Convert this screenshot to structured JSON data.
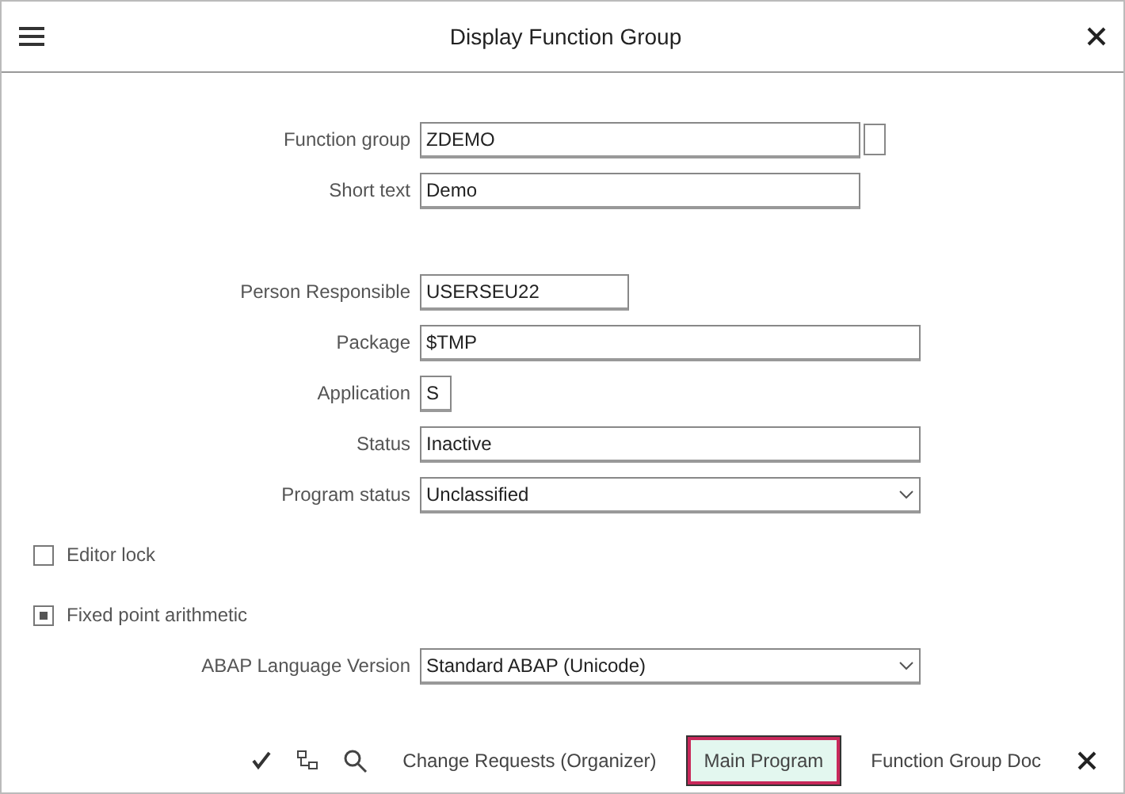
{
  "window": {
    "title": "Display Function Group"
  },
  "fields": [
    {
      "kind": "input",
      "label": "Function group",
      "value": "ZDEMO"
    },
    {
      "kind": "input",
      "label": "Short text",
      "value": "Demo"
    },
    {
      "kind": "gap"
    },
    {
      "kind": "input",
      "label": "Person Responsible",
      "value": "USERSEU22"
    },
    {
      "kind": "input",
      "label": "Package",
      "value": "$TMP"
    },
    {
      "kind": "input",
      "label": "Application",
      "value": "S"
    },
    {
      "kind": "input",
      "label": "Status",
      "value": "Inactive"
    },
    {
      "kind": "select",
      "label": "Program status",
      "value": "Unclassified"
    },
    {
      "kind": "checkbox",
      "label": "Editor lock",
      "checked": false
    },
    {
      "kind": "checkbox",
      "label": "Fixed point arithmetic",
      "checked": true
    },
    {
      "kind": "select",
      "label": "ABAP Language Version",
      "value": "Standard ABAP (Unicode)"
    }
  ],
  "toolbar": [
    {
      "kind": "icon"
    },
    {
      "kind": "icon"
    },
    {
      "kind": "icon"
    },
    {
      "kind": "text",
      "label": "Change Requests (Organizer)",
      "selected": false
    },
    {
      "kind": "text",
      "label": "Main Program",
      "selected": true
    },
    {
      "kind": "text",
      "label": "Function Group Doc",
      "selected": false
    }
  ]
}
